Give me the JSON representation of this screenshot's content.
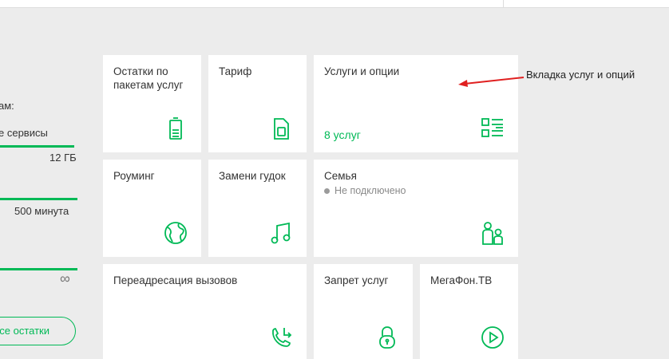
{
  "left_summary": {
    "heading_fragment": "ам:",
    "services_fragment": "е сервисы",
    "internet": {
      "value": "12 ГБ",
      "fill_fraction": 1.0
    },
    "minutes": {
      "value": "500 минута",
      "fill_fraction": 1.0
    },
    "sms": {
      "value": "∞",
      "fill_fraction": 1.0
    },
    "all_remains_button": "се остатки"
  },
  "tiles": {
    "remains": {
      "title": "Остатки по пакетам услуг",
      "icon": "battery-icon"
    },
    "tariff": {
      "title": "Тариф",
      "icon": "sim-card-icon"
    },
    "services": {
      "title": "Услуги и опции",
      "count": "8 услуг",
      "icon": "list-icon"
    },
    "roaming": {
      "title": "Роуминг",
      "icon": "globe-icon"
    },
    "ringtone": {
      "title": "Замени гудок",
      "icon": "music-note-icon"
    },
    "family": {
      "title": "Семья",
      "status": "Не подключено",
      "icon": "family-icon"
    },
    "forwarding": {
      "title": "Переадресация вызовов",
      "icon": "phone-forward-icon"
    },
    "block": {
      "title": "Запрет услуг",
      "icon": "lock-icon"
    },
    "tv": {
      "title": "МегаФон.ТВ",
      "icon": "play-icon"
    }
  },
  "annotation": {
    "text": "Вкладка услуг и опций",
    "color": "#e02020"
  },
  "colors": {
    "accent": "#00b956",
    "background": "#ececec",
    "tile": "#ffffff"
  }
}
